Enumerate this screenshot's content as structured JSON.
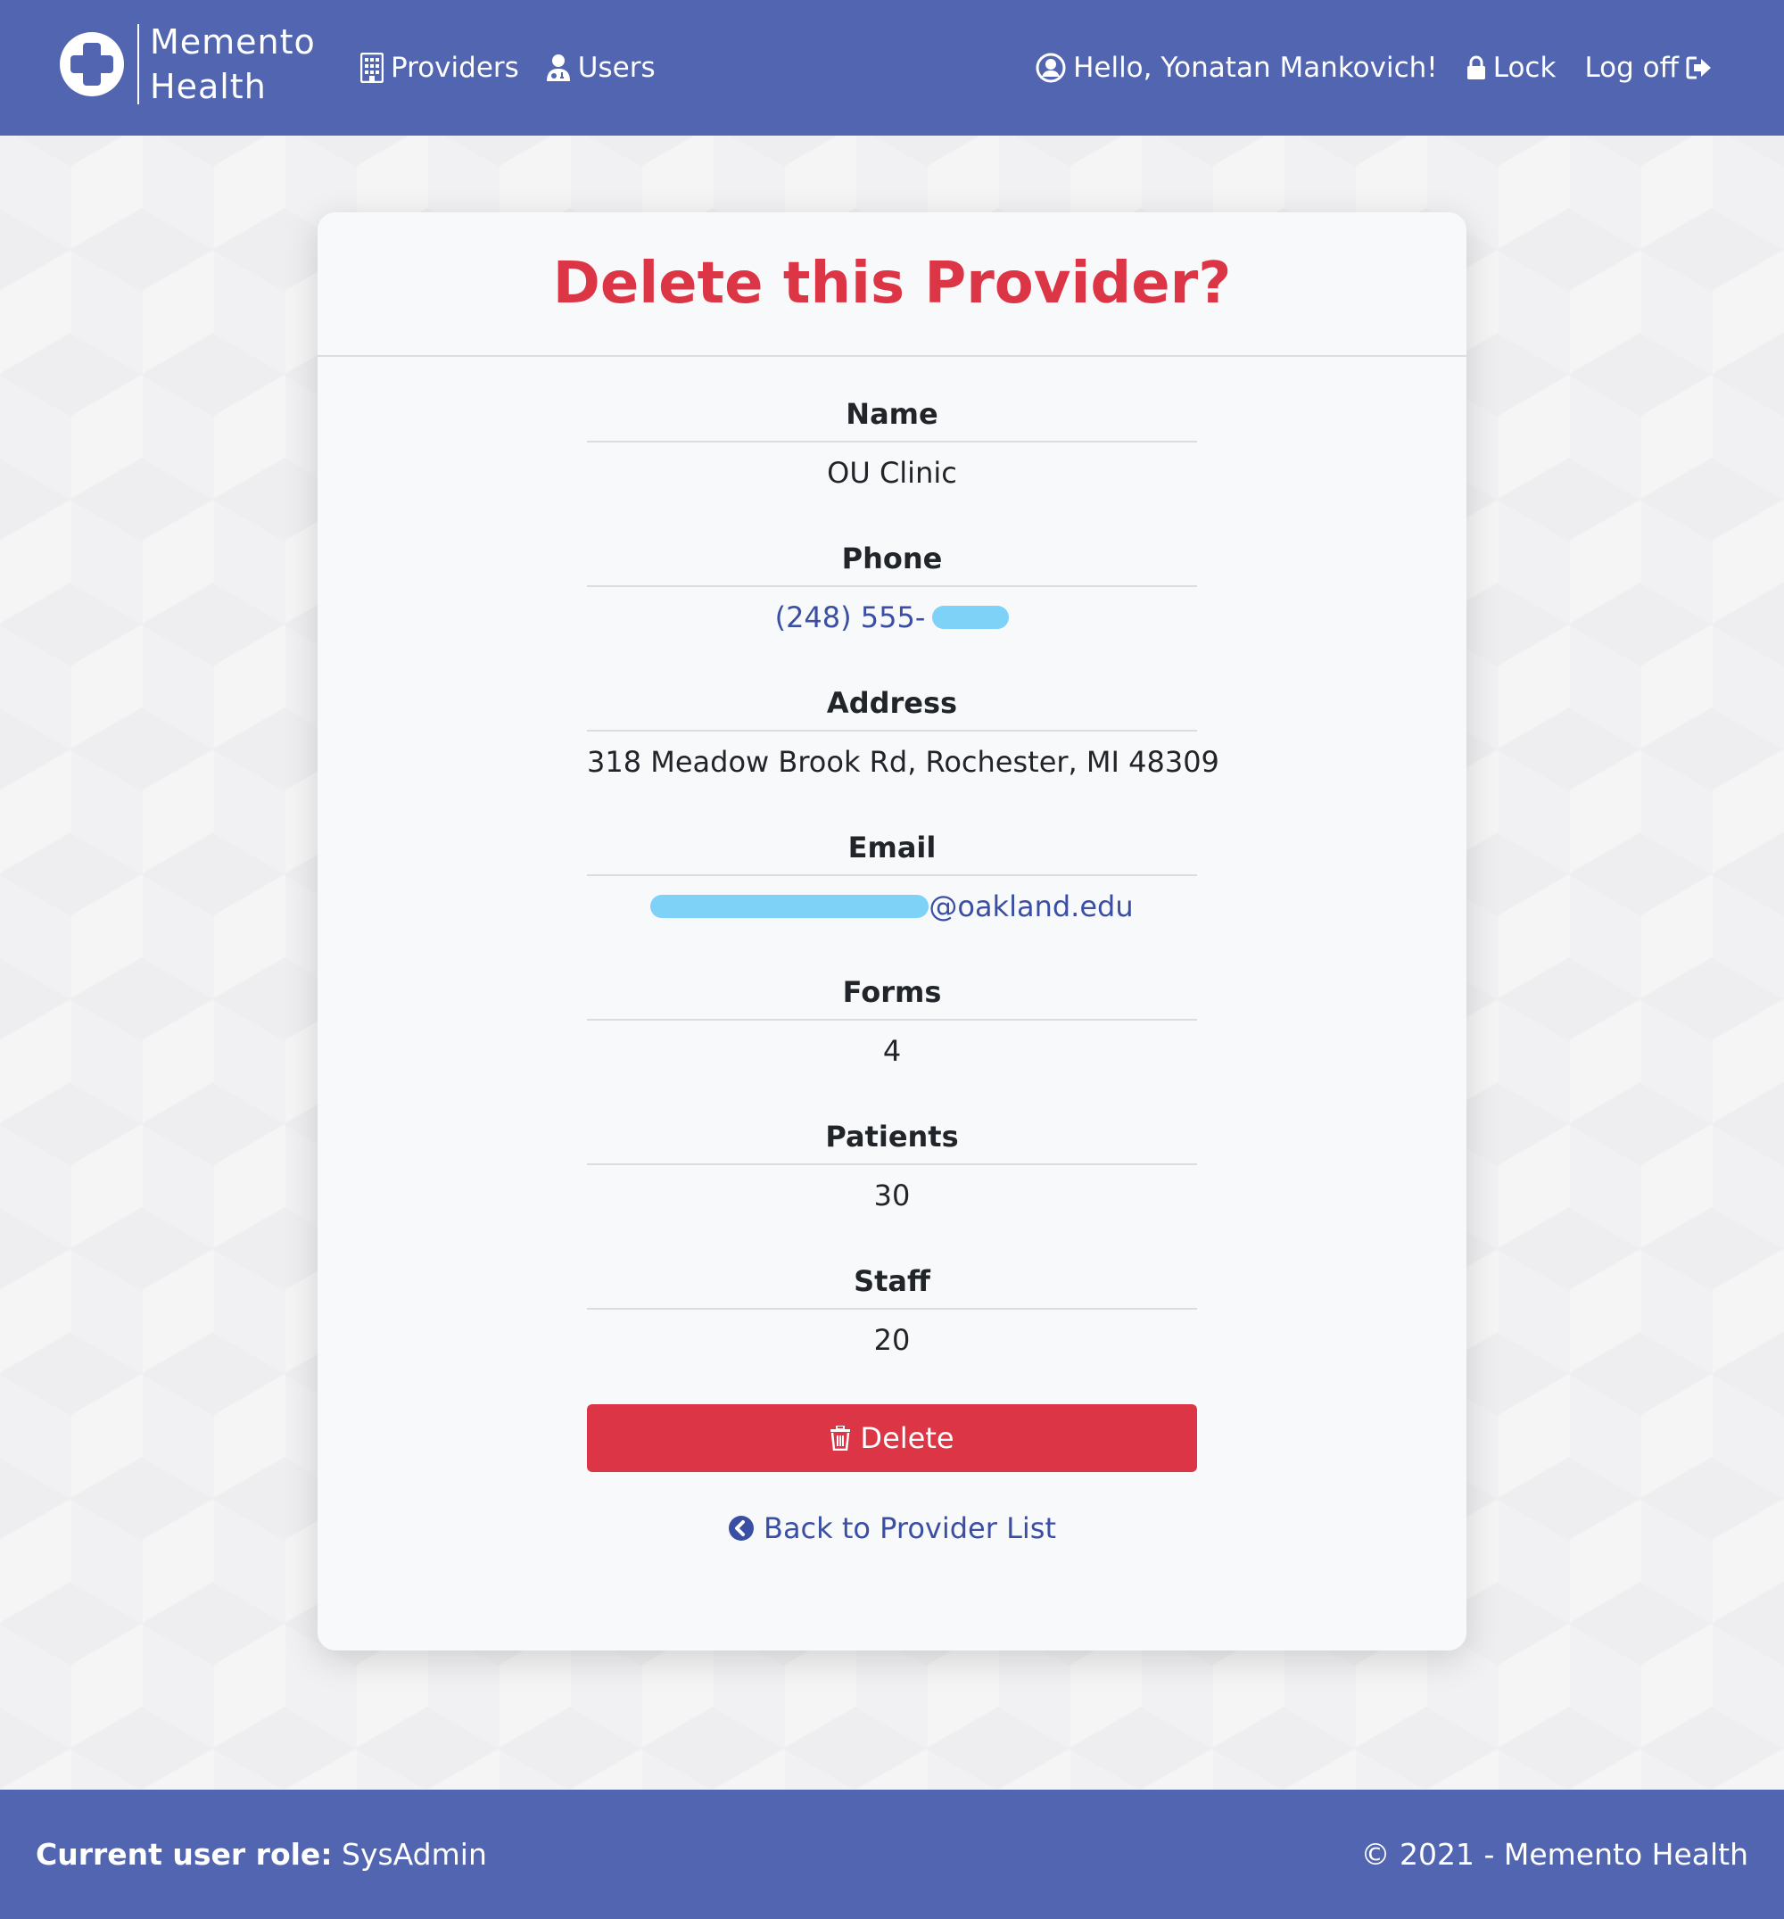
{
  "brand": {
    "line1": "Memento",
    "line2": "Health"
  },
  "nav": {
    "providers": "Providers",
    "users": "Users",
    "greeting": "Hello, Yonatan Mankovich!",
    "lock": "Lock",
    "logoff": "Log off"
  },
  "page": {
    "title": "Delete this Provider?",
    "fields": {
      "name": {
        "label": "Name",
        "value": "OU Clinic"
      },
      "phone": {
        "label": "Phone",
        "value": "(248) 555-"
      },
      "address": {
        "label": "Address",
        "value": "318 Meadow Brook Rd, Rochester, MI 48309"
      },
      "email": {
        "label": "Email",
        "value": "@oakland.edu"
      },
      "forms": {
        "label": "Forms",
        "value": "4"
      },
      "patients": {
        "label": "Patients",
        "value": "30"
      },
      "staff": {
        "label": "Staff",
        "value": "20"
      }
    },
    "delete_label": "Delete",
    "back_label": "Back to Provider List"
  },
  "footer": {
    "role_label": "Current user role:",
    "role_value": "SysAdmin",
    "copyright": "© 2021 - Memento Health"
  },
  "colors": {
    "navbar": "#5265b0",
    "danger": "#dc3545",
    "link": "#3a4fa3",
    "redaction": "#7fd2f7"
  }
}
